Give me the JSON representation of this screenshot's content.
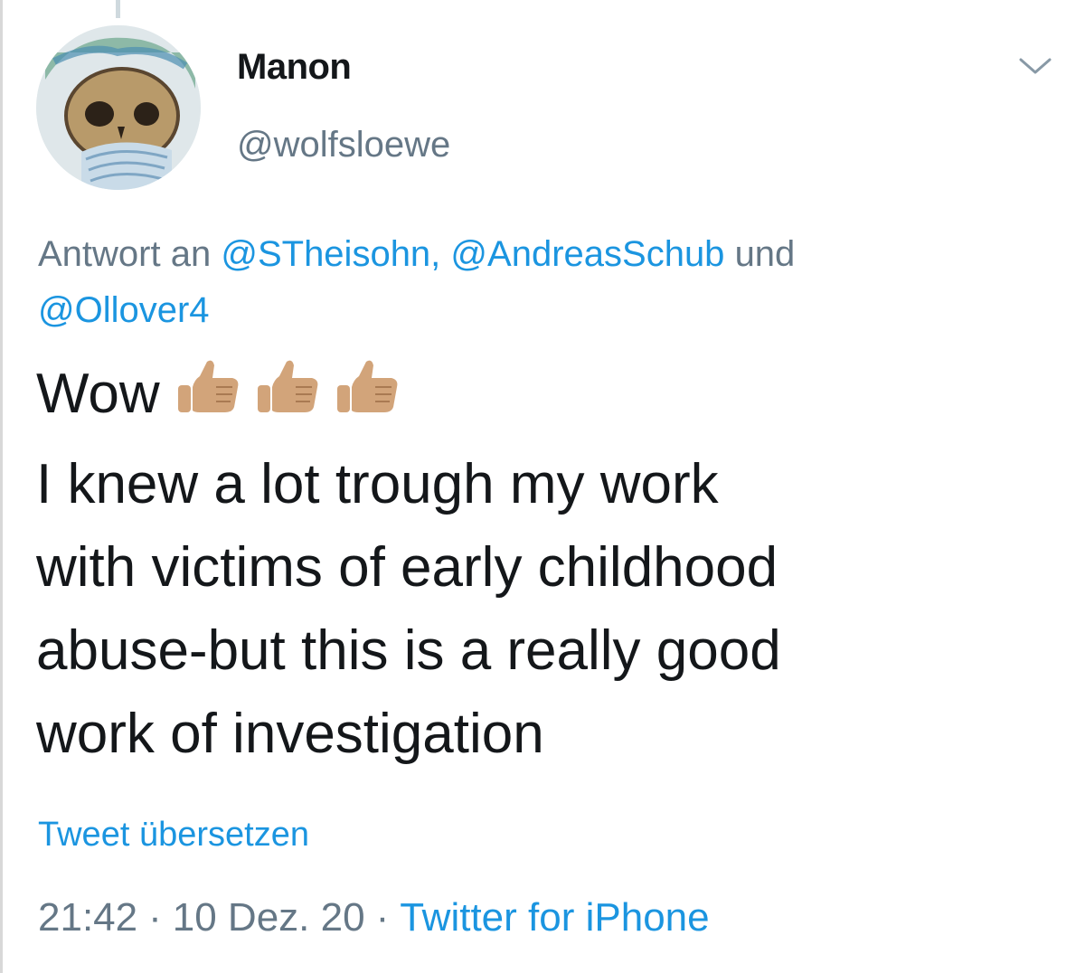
{
  "tweet": {
    "author": {
      "display_name": "Manon",
      "handle": "@wolfsloewe",
      "avatar_icon": "skull-avatar-icon"
    },
    "more_icon": "chevron-down-icon",
    "reply_to": {
      "prefix": "Antwort an",
      "mentions": [
        "@STheisohn,",
        "@AndreasSchub",
        "@Ollover4"
      ],
      "conjunction": "und"
    },
    "text_lines": [
      "Wow",
      "I knew a lot trough my work",
      "with victims of early childhood",
      "abuse-but this is a really good",
      "work of investigation"
    ],
    "emoji": [
      "thumbs-up-medium-light-skin-icon",
      "thumbs-up-medium-light-skin-icon",
      "thumbs-up-medium-light-skin-icon"
    ],
    "translate_label": "Tweet übersetzen",
    "time": "21:42",
    "date": "10 Dez. 20",
    "separator": "·",
    "source": "Twitter for iPhone"
  },
  "colors": {
    "text_primary": "#14171a",
    "text_secondary": "#657786",
    "link": "#1b95e0",
    "emoji_skin": "#d2a47a"
  }
}
